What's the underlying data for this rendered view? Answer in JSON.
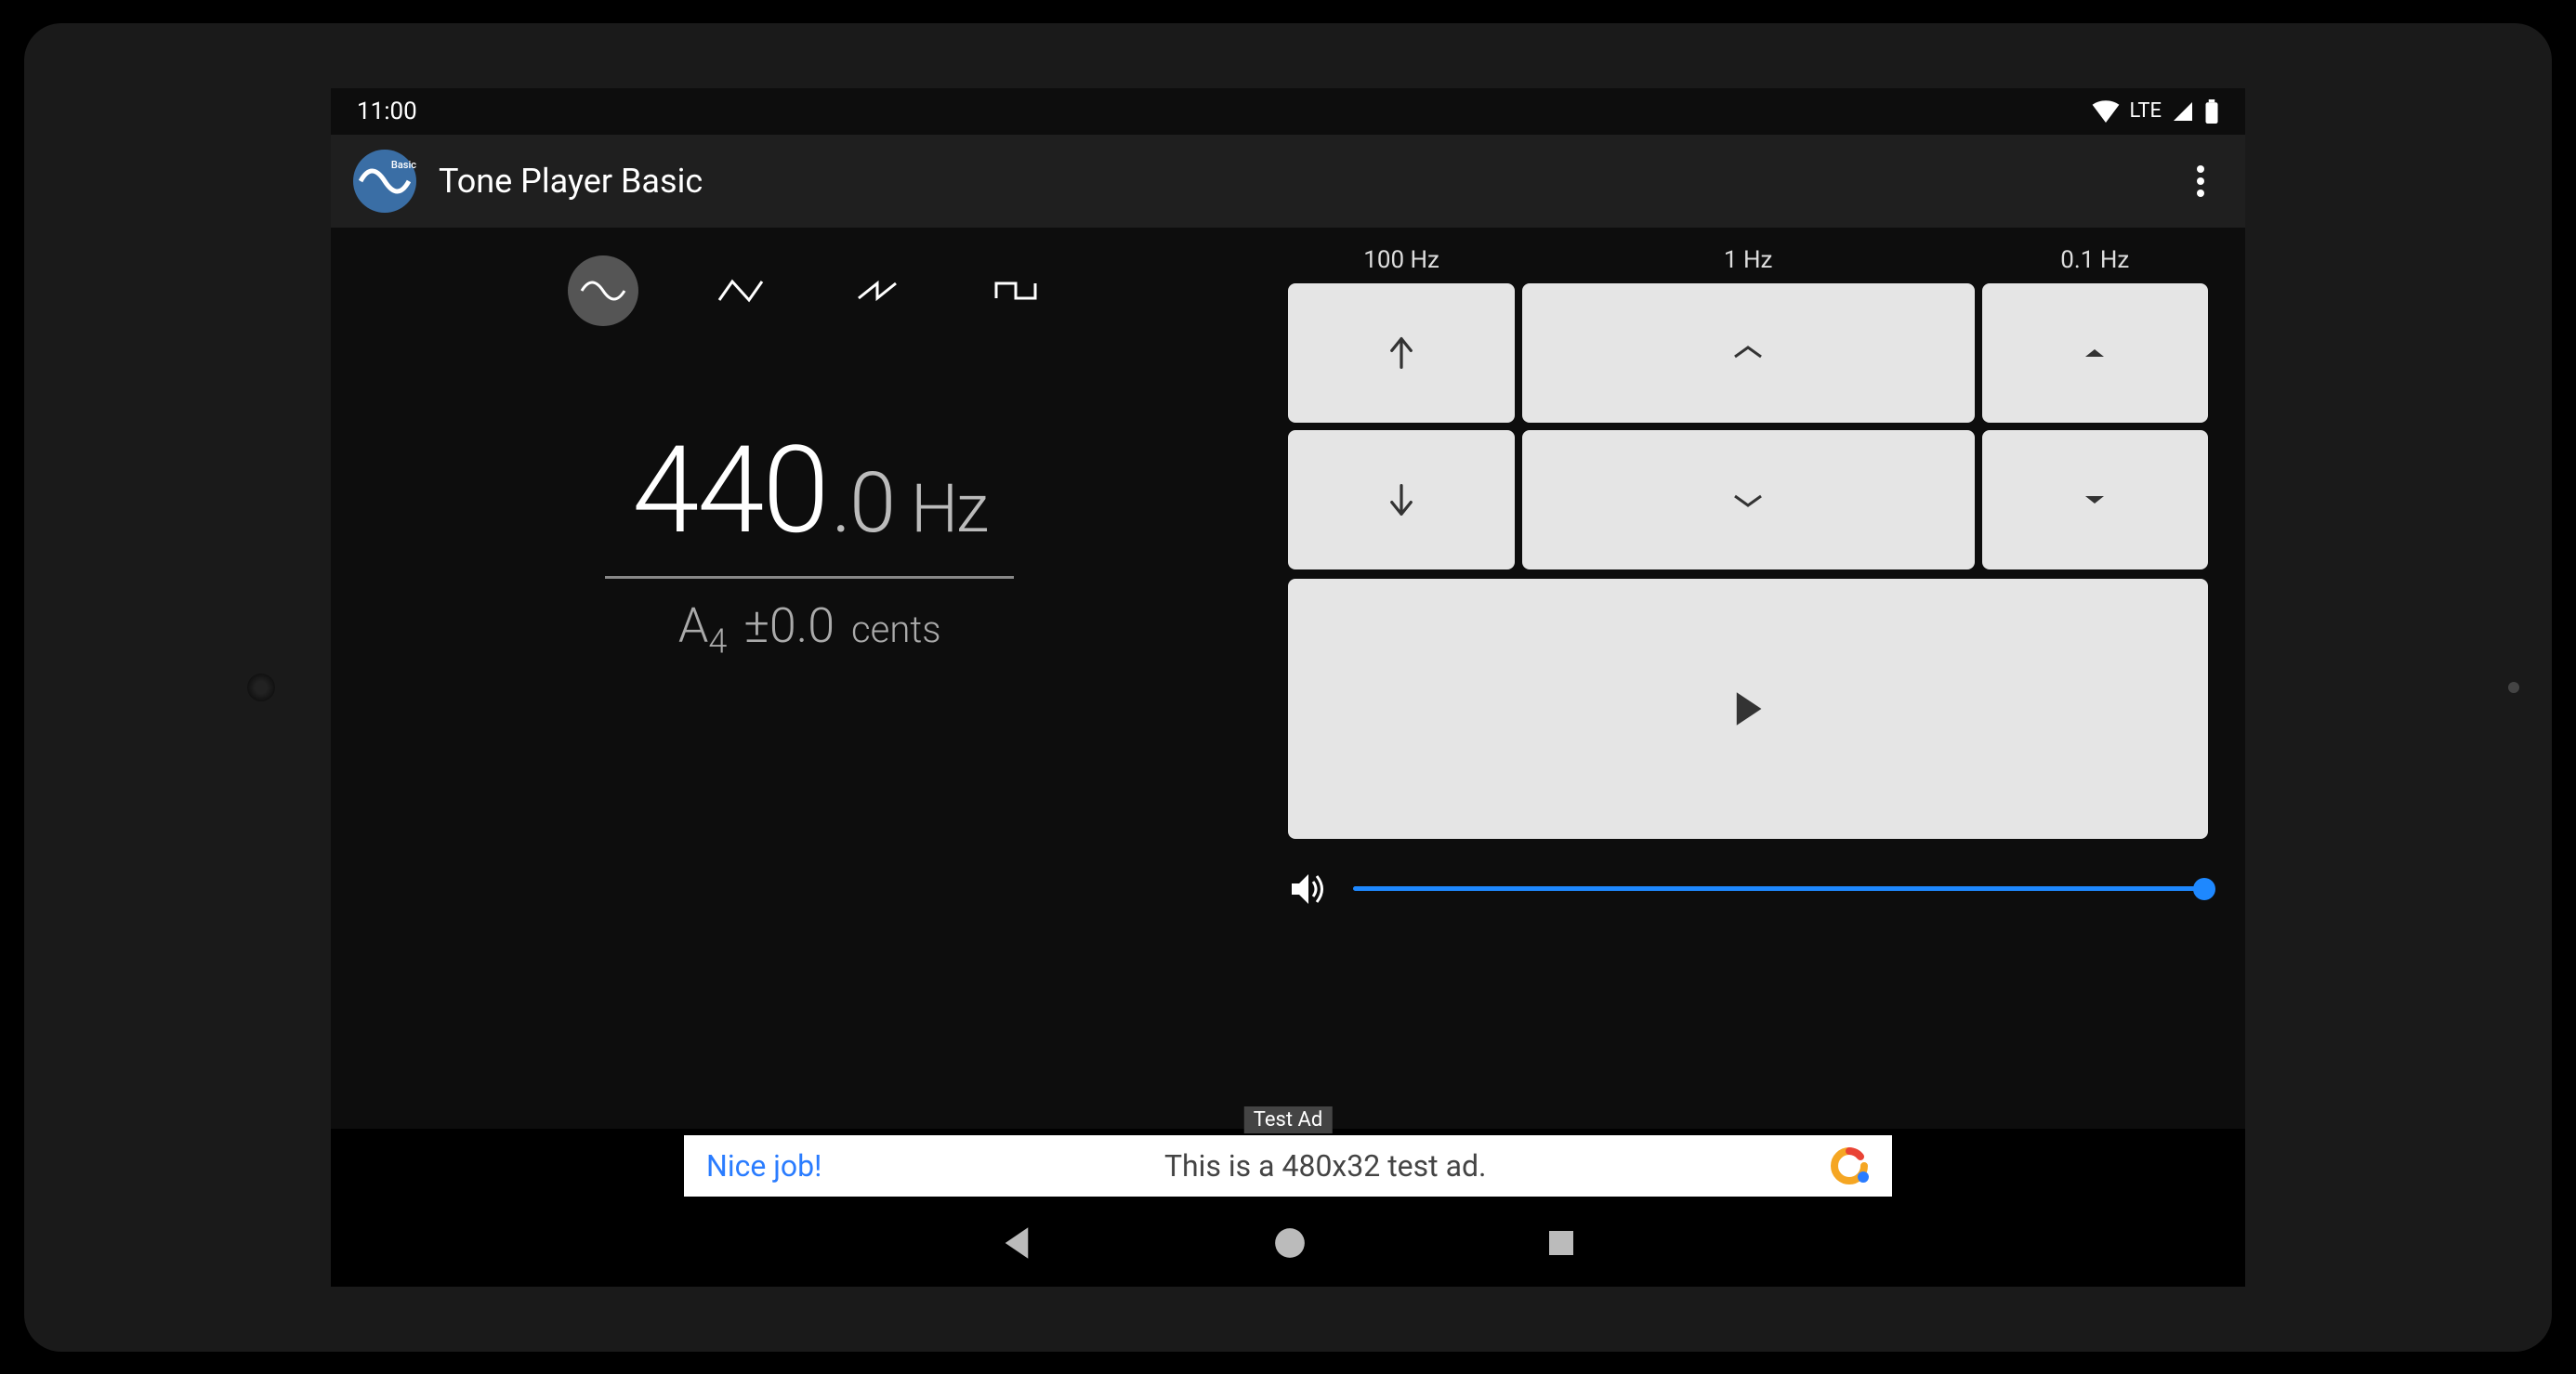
{
  "status": {
    "time": "11:00",
    "network": "LTE"
  },
  "app": {
    "title": "Tone Player Basic",
    "icon_badge": "Basic"
  },
  "waveforms": {
    "selected": "sine",
    "options": [
      "sine",
      "triangle",
      "sawtooth",
      "square"
    ]
  },
  "frequency": {
    "integer": "440",
    "decimal": ".0",
    "unit": "Hz",
    "note": "A",
    "octave": "4",
    "cents": "±0.0",
    "cents_label": "cents"
  },
  "steps": {
    "labels": [
      "100 Hz",
      "1 Hz",
      "0.1 Hz"
    ]
  },
  "volume": {
    "value": 100
  },
  "ad": {
    "badge": "Test Ad",
    "headline": "Nice job!",
    "body": "This is a 480x32 test ad."
  }
}
